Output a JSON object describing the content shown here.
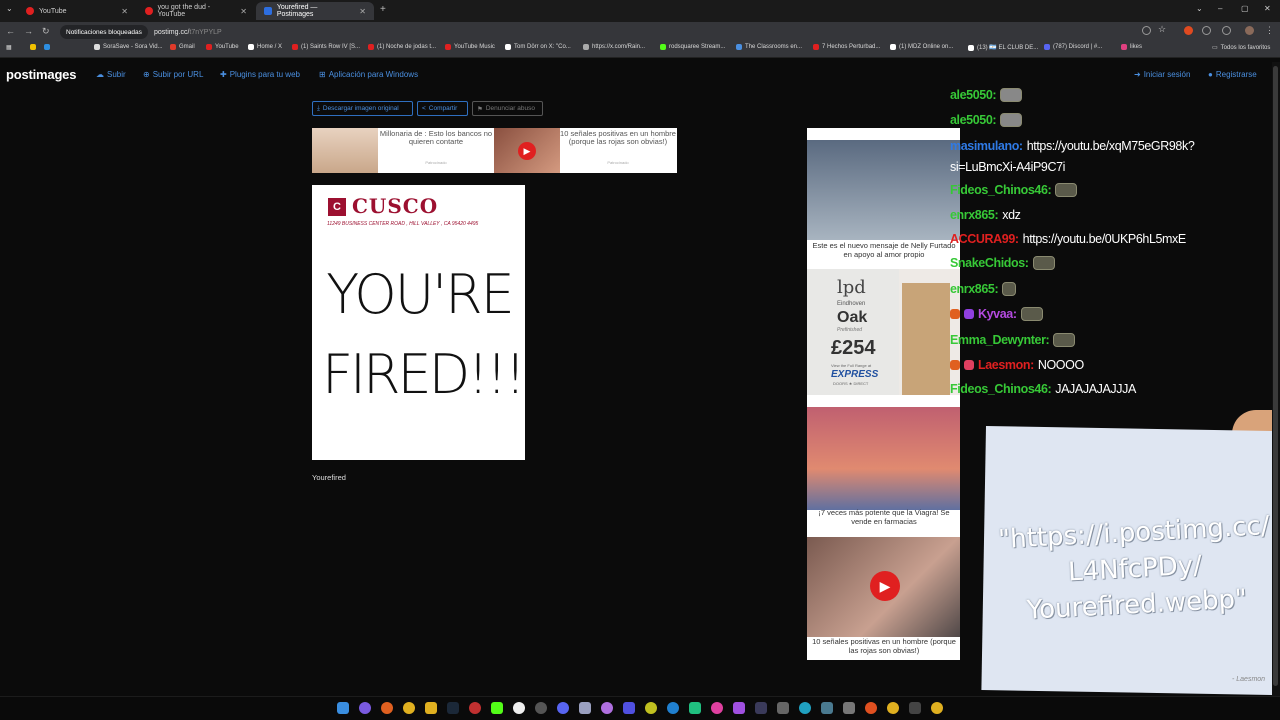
{
  "browser": {
    "tabs": [
      {
        "label": "YouTube",
        "active": false
      },
      {
        "label": "you got the dud - YouTube",
        "active": false
      },
      {
        "label": "Yourefired — Postimages",
        "active": true
      }
    ],
    "new_tab": "+",
    "window_controls": [
      "⌄",
      "–",
      "▢",
      "✕"
    ],
    "blocked_label": "Notificaciones bloqueadas",
    "url_host": "postimg.cc/",
    "url_path": "t7nYPYLP",
    "bookmarks": [
      "SoraSave - Sora Vid...",
      "Gmail",
      "YouTube",
      "Home / X",
      "(1) Saints Row IV [S...",
      "(1) Noche de jodas t...",
      "YouTube Music",
      "Tom Dörr on X: \"Co...",
      "https://x.com/Rain...",
      "rodsquaree Stream...",
      "The Classrooms en...",
      "7 Hechos Perturbad...",
      "(1) MDZ Online on...",
      "(13) 🇦🇷 EL CLUB DE...",
      "(787) Discord | #...",
      "likes"
    ],
    "favorites_label": "Todos los favoritos"
  },
  "site": {
    "logo": "postimages",
    "nav": [
      "Subir",
      "Subir por URL",
      "Plugins para tu web",
      "Aplicación para Windows"
    ],
    "login": "Iniciar sesión",
    "register": "Registrarse",
    "buttons": {
      "download": "Descargar imagen original",
      "share": "Compartir",
      "report": "Denunciar abuso"
    },
    "image_title": "Yourefired"
  },
  "main_image": {
    "brand": "CUSCO",
    "address": "11249 BUSINESS CENTER ROAD , HILL VALLEY , CA 95420 4495",
    "line1": "YOU'RE",
    "line2": "FIRED!!!"
  },
  "ads": {
    "strip_left_title": "Millonaria de : Esto los bancos no quieren contarte",
    "strip_left_source": "Patrocinado",
    "strip_right_title": "10 señales positivas en un hombre (porque las rojas son obvias!)",
    "strip_right_source": "Patrocinado",
    "col1_caption": "Este es el nuevo mensaje de Nelly Furtado en apoyo al amor propio",
    "lpd_logo": "lpd",
    "lpd_city": "Eindhoven",
    "lpd_product": "Oak",
    "lpd_finish": "Prefinished",
    "lpd_price": "£254",
    "lpd_range": "View the Full Range at",
    "lpd_express": "EXPRESS",
    "lpd_doors": "DOORS ★ DIRECT",
    "col3_caption": "¡7 veces más potente que la Viagra! Se vende en farmacias",
    "col4_caption": "10 señales positivas en un hombre (porque las rojas son obvias!)"
  },
  "chat": [
    {
      "user": "ale5050:",
      "msg": "",
      "color": "#37c837"
    },
    {
      "user": "ale5050:",
      "msg": "",
      "color": "#37c837"
    },
    {
      "user": "masimulano:",
      "msg": "https://youtu.be/xqM75eGR98k?",
      "color": "#2f7ae5"
    },
    {
      "user": "",
      "msg": "si=LuBmcXi-A4iP9C7i",
      "color": "#2f7ae5"
    },
    {
      "user": "Fideos_Chinos46:",
      "msg": "",
      "color": "#37c837"
    },
    {
      "user": "enrx865:",
      "msg": "xdz",
      "color": "#37c837"
    },
    {
      "user": "ACCURA99:",
      "msg": "https://youtu.be/0UKP6hL5mxE",
      "color": "#e02020"
    },
    {
      "user": "SnakeChidos:",
      "msg": "",
      "color": "#37c837"
    },
    {
      "user": "enrx865:",
      "msg": "",
      "color": "#37c837"
    },
    {
      "user": "Kyvaa:",
      "msg": "",
      "color": "#b44ae0"
    },
    {
      "user": "Emma_Dewynter:",
      "msg": "",
      "color": "#37c837"
    },
    {
      "user": "Laesmon:",
      "msg": "NOOOO",
      "color": "#e02020"
    },
    {
      "user": "Fideos_Chinos46:",
      "msg": "JAJAJAJAJJJA",
      "color": "#37c837"
    }
  ],
  "paper": {
    "line1": "\"https://i.postimg.cc/",
    "line2": "L4NfcPDy/",
    "line3": "Yourefired.webp\"",
    "signature": "- Laesmon"
  }
}
